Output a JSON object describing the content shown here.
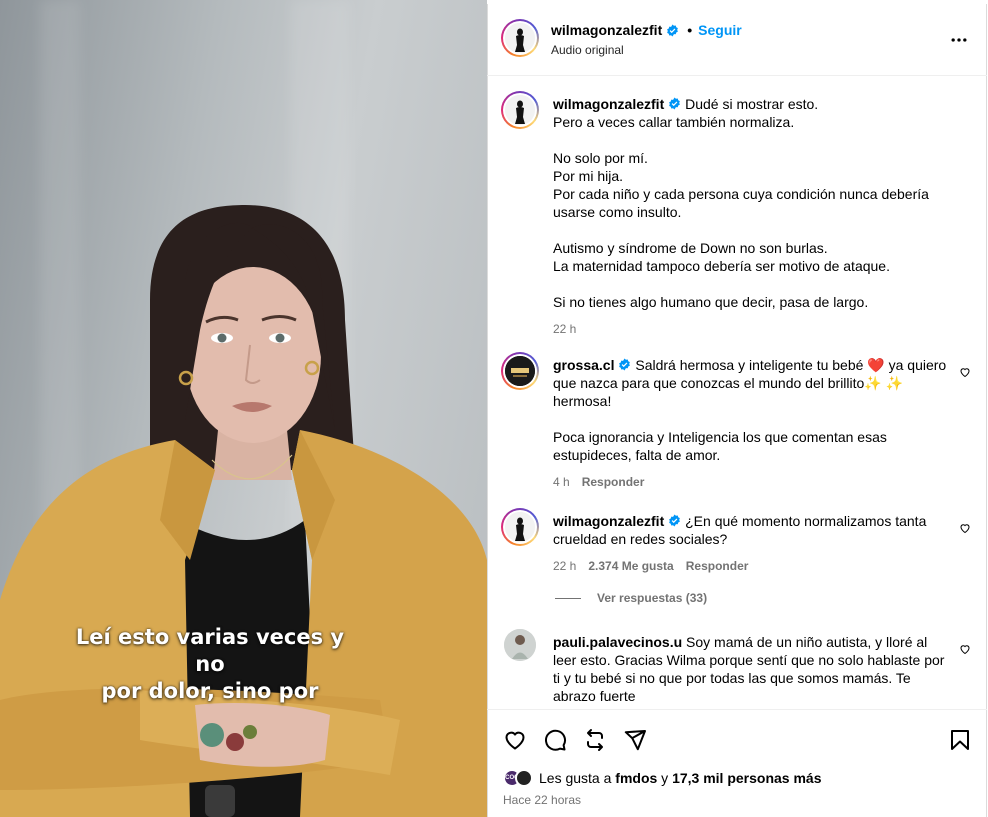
{
  "colors": {
    "accent": "#0095f6",
    "meta": "#737373",
    "jacket": "#d8a951",
    "heart": "#e0245e"
  },
  "media": {
    "caption_line1": "Leí esto varias veces y no",
    "caption_line2": "por dolor, sino por"
  },
  "header": {
    "username": "wilmagonzalezfit",
    "separator": "•",
    "follow_label": "Seguir",
    "subtitle": "Audio original"
  },
  "post": {
    "username": "wilmagonzalezfit",
    "text_first": "Dudé si mostrar esto.",
    "text_rest": "Pero a veces callar también normaliza.\n\nNo solo por mí.\nPor mi hija.\nPor cada niño y cada persona cuya condición nunca debería usarse como insulto.\n\nAutismo y síndrome de Down no son burlas.\nLa maternidad tampoco debería ser motivo de ataque.\n\nSi no tienes algo humano que decir, pasa de largo.",
    "time": "22 h"
  },
  "comments": [
    {
      "username": "grossa.cl",
      "text": "Saldrá hermosa y inteligente tu bebé ❤️ ya quiero que nazca para que conozcas el mundo del brillito✨ ✨ hermosa!\n\nPoca ignorancia y Inteligencia los que comentan esas estupideces, falta de amor.",
      "time": "4 h",
      "reply_label": "Responder"
    },
    {
      "username": "wilmagonzalezfit",
      "text": "¿En qué momento normalizamos tanta crueldad en redes sociales?",
      "time": "22 h",
      "likes": "2.374 Me gusta",
      "reply_label": "Responder",
      "view_replies": "Ver respuestas (33)"
    },
    {
      "username": "pauli.palavecinos.u",
      "text": "Soy mamá de un niño autista, y lloré al leer esto. Gracias Wilma porque sentí que no solo hablaste por ti y tu bebé si no que por todas las que somos mamás. Te abrazo fuerte"
    }
  ],
  "likes": {
    "prefix": "Les gusta a",
    "user": "fmdos",
    "middle": "y",
    "count": "17,3 mil personas más"
  },
  "posted_ago": "Hace 22 horas",
  "icons": [
    "heart-icon",
    "comment-icon",
    "repost-icon",
    "share-icon",
    "bookmark-icon",
    "more-icon",
    "verified-icon"
  ]
}
